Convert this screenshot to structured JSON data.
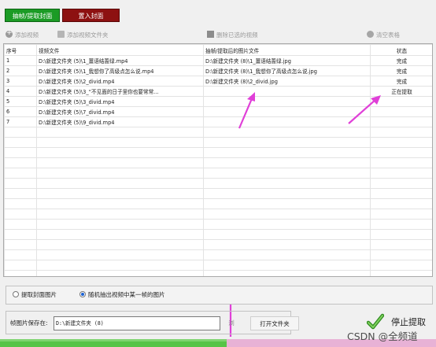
{
  "tabs": {
    "extract": "抽帧/提取封面",
    "insert": "置入封面"
  },
  "toolbar": {
    "add_video": "添加视频",
    "add_folder": "添加视频文件夹",
    "remove_selected": "删除已选的视频",
    "clear_table": "清空表格"
  },
  "table": {
    "headers": [
      "序号",
      "视频文件",
      "抽帧/提取后的图片文件",
      "状态"
    ],
    "rows": [
      [
        "1",
        "D:\\新建文件夹 (5)\\1_薑语结蔷绿.mp4",
        "D:\\新建文件夹 (8)\\1_薑语结蔷绿.jpg",
        "完成"
      ],
      [
        "2",
        "D:\\新建文件夹 (5)\\1_我想你了高级点怎么说.mp4",
        "D:\\新建文件夹 (8)\\1_我想你了高级点怎么说.jpg",
        "完成"
      ],
      [
        "3",
        "D:\\新建文件夹 (5)\\2_divid.mp4",
        "D:\\新建文件夹 (8)\\2_divid.jpg",
        "完成"
      ],
      [
        "4",
        "D:\\新建文件夹 (5)\\3_“不见面的日子里你也要常常...",
        "",
        "正在提取"
      ],
      [
        "5",
        "D:\\新建文件夹 (5)\\3_divid.mp4",
        "",
        ""
      ],
      [
        "6",
        "D:\\新建文件夹 (5)\\7_divid.mp4",
        "",
        ""
      ],
      [
        "7",
        "D:\\新建文件夹 (5)\\9_divid.mp4",
        "",
        ""
      ]
    ],
    "empty_rows": 17
  },
  "options": {
    "cover": "提取封面图片",
    "random_frame": "随机抽出视频中某一帧的图片",
    "selected": "random_frame"
  },
  "save": {
    "label": "帧图片保存在:",
    "path": "D:\\新建文件夹 (8)",
    "browse": "浏",
    "open_folder": "打开文件夹"
  },
  "stop_label": "停止提取",
  "progress": 0.52,
  "watermark": "CSDN @全频道",
  "colors": {
    "extract_tab": "#1b9b25",
    "insert_tab": "#8d1111",
    "arrow": "#e040d8",
    "progress_fill": "#56c447",
    "progress_track": "#e8b2d6"
  }
}
